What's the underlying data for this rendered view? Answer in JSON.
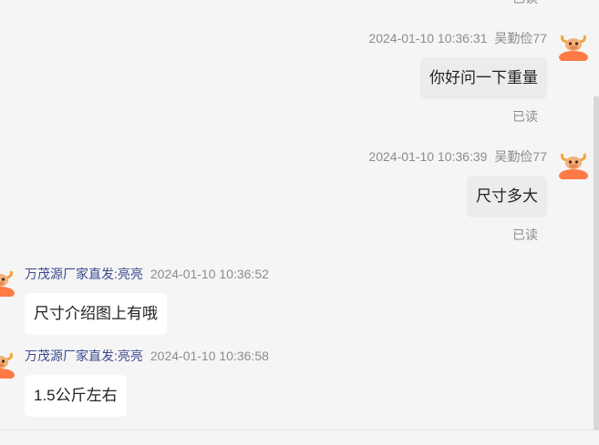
{
  "read_label": "已读",
  "messages": [
    {
      "time": "2024-01-10 10:36:31",
      "sender": "吴勤俭77",
      "text": "你好问一下重量",
      "status": "已读"
    },
    {
      "time": "2024-01-10 10:36:39",
      "sender": "吴勤俭77",
      "text": "尺寸多大",
      "status": "已读"
    },
    {
      "time": "2024-01-10 10:36:52",
      "sender": "万茂源厂家直发:亮亮",
      "text": "尺寸介绍图上有哦"
    },
    {
      "time": "2024-01-10 10:36:58",
      "sender": "万茂源厂家直发:亮亮",
      "text": "1.5公斤左右"
    }
  ],
  "colors": {
    "background": "#f5f5f5",
    "self_bubble": "#ececec",
    "other_bubble": "#ffffff",
    "shop_name": "#3d4a8f",
    "meta": "#8c8c8c",
    "avatar": "#ff7a45"
  },
  "icons": {
    "user_avatar": "cow-avatar-icon",
    "shop_avatar": "cow-avatar-icon"
  }
}
